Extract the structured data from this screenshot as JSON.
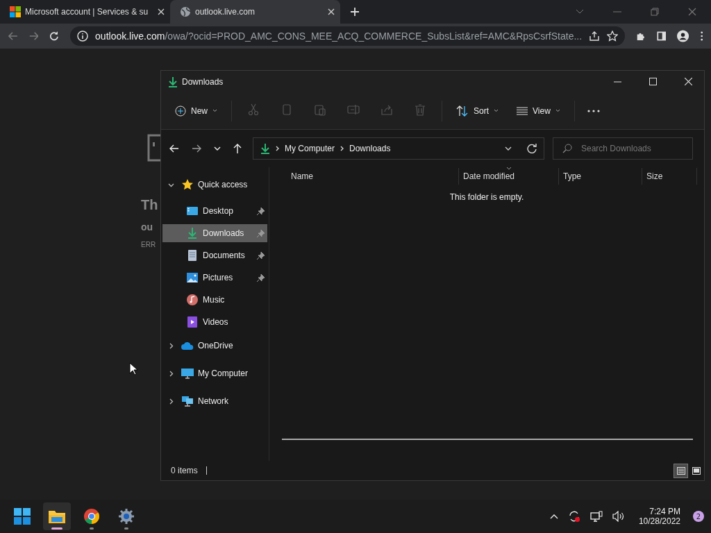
{
  "browser": {
    "tabs": [
      {
        "title": "Microsoft account | Services & su",
        "kind": "microsoft",
        "selected": false
      },
      {
        "title": "outlook.live.com",
        "kind": "globe",
        "selected": true
      }
    ],
    "address": {
      "host": "outlook.live.com",
      "path": "/owa/?ocid=PROD_AMC_CONS_MEE_ACQ_COMMERCE_SubsList&ref=AMC&RpsCsrfState..."
    }
  },
  "page_behind": {
    "heading": "Th",
    "subheading": "ou",
    "error": "ERR"
  },
  "explorer": {
    "title": "Downloads",
    "toolbar": {
      "new_label": "New",
      "commands": [
        {
          "kind": "cut",
          "disabled": true
        },
        {
          "kind": "copy",
          "disabled": true
        },
        {
          "kind": "paste",
          "disabled": true
        },
        {
          "kind": "rename",
          "disabled": true
        },
        {
          "kind": "share",
          "disabled": true
        },
        {
          "kind": "delete",
          "disabled": true
        }
      ],
      "sort_label": "Sort",
      "view_label": "View"
    },
    "breadcrumb": [
      "My Computer",
      "Downloads"
    ],
    "search": {
      "placeholder": "Search Downloads"
    },
    "nav": [
      {
        "label": "Quick access",
        "kind": "star",
        "expanded": true,
        "children": [
          {
            "label": "Desktop",
            "kind": "desktop",
            "pinned": true,
            "selected": false
          },
          {
            "label": "Downloads",
            "kind": "download",
            "pinned": true,
            "selected": true
          },
          {
            "label": "Documents",
            "kind": "document",
            "pinned": true,
            "selected": false
          },
          {
            "label": "Pictures",
            "kind": "pictures",
            "pinned": true,
            "selected": false
          },
          {
            "label": "Music",
            "kind": "music",
            "pinned": false,
            "selected": false
          },
          {
            "label": "Videos",
            "kind": "videos",
            "pinned": false,
            "selected": false
          }
        ]
      },
      {
        "label": "OneDrive",
        "kind": "cloud",
        "expanded": false
      },
      {
        "label": "My Computer",
        "kind": "monitor",
        "expanded": false
      },
      {
        "label": "Network",
        "kind": "network",
        "expanded": false
      }
    ],
    "columns": [
      {
        "label": "Name",
        "sorted": false
      },
      {
        "label": "Date modified",
        "sorted": true
      },
      {
        "label": "Type",
        "sorted": false
      },
      {
        "label": "Size",
        "sorted": false
      }
    ],
    "empty_message": "This folder is empty.",
    "status": "0 items",
    "view_buttons": [
      {
        "kind": "details",
        "selected": true
      },
      {
        "kind": "tiles",
        "selected": false
      }
    ]
  },
  "taskbar": {
    "apps": [
      {
        "kind": "files",
        "active": true
      },
      {
        "kind": "chrome",
        "active": false
      },
      {
        "kind": "settings",
        "active": false
      }
    ],
    "time": "7:24 PM",
    "date": "10/28/2022",
    "notifications": "2"
  }
}
